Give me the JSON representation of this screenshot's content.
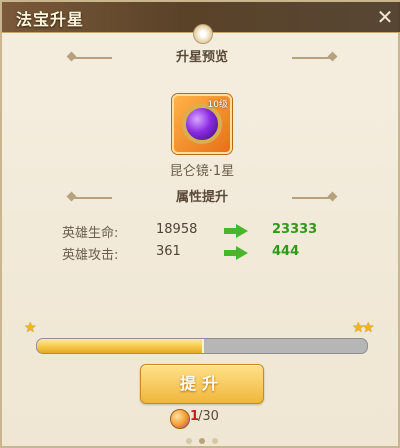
{
  "window": {
    "title": "法宝升星",
    "close_icon": "close-icon"
  },
  "preview": {
    "header": "升星预览"
  },
  "item": {
    "name": "昆仑镜·1星",
    "level_badge": "10级",
    "icon": "mirror-artifact-icon"
  },
  "attributes": {
    "header": "属性提升",
    "rows": [
      {
        "label": "英雄生命:",
        "old": "18958",
        "new": "23333"
      },
      {
        "label": "英雄攻击:",
        "old": "361",
        "new": "444"
      }
    ]
  },
  "progress": {
    "fill_fraction": 0.5,
    "left_stars": 1,
    "right_stars": 2
  },
  "button": {
    "upgrade_label": "提升"
  },
  "cost": {
    "current": "1",
    "separator_total": "/30",
    "icon": "upgrade-material-icon"
  },
  "colors": {
    "arrow": "#49b52a",
    "new_value": "#2f9a1a",
    "progress_fill": "#f4c542",
    "cost_current": "#d21b1b"
  }
}
